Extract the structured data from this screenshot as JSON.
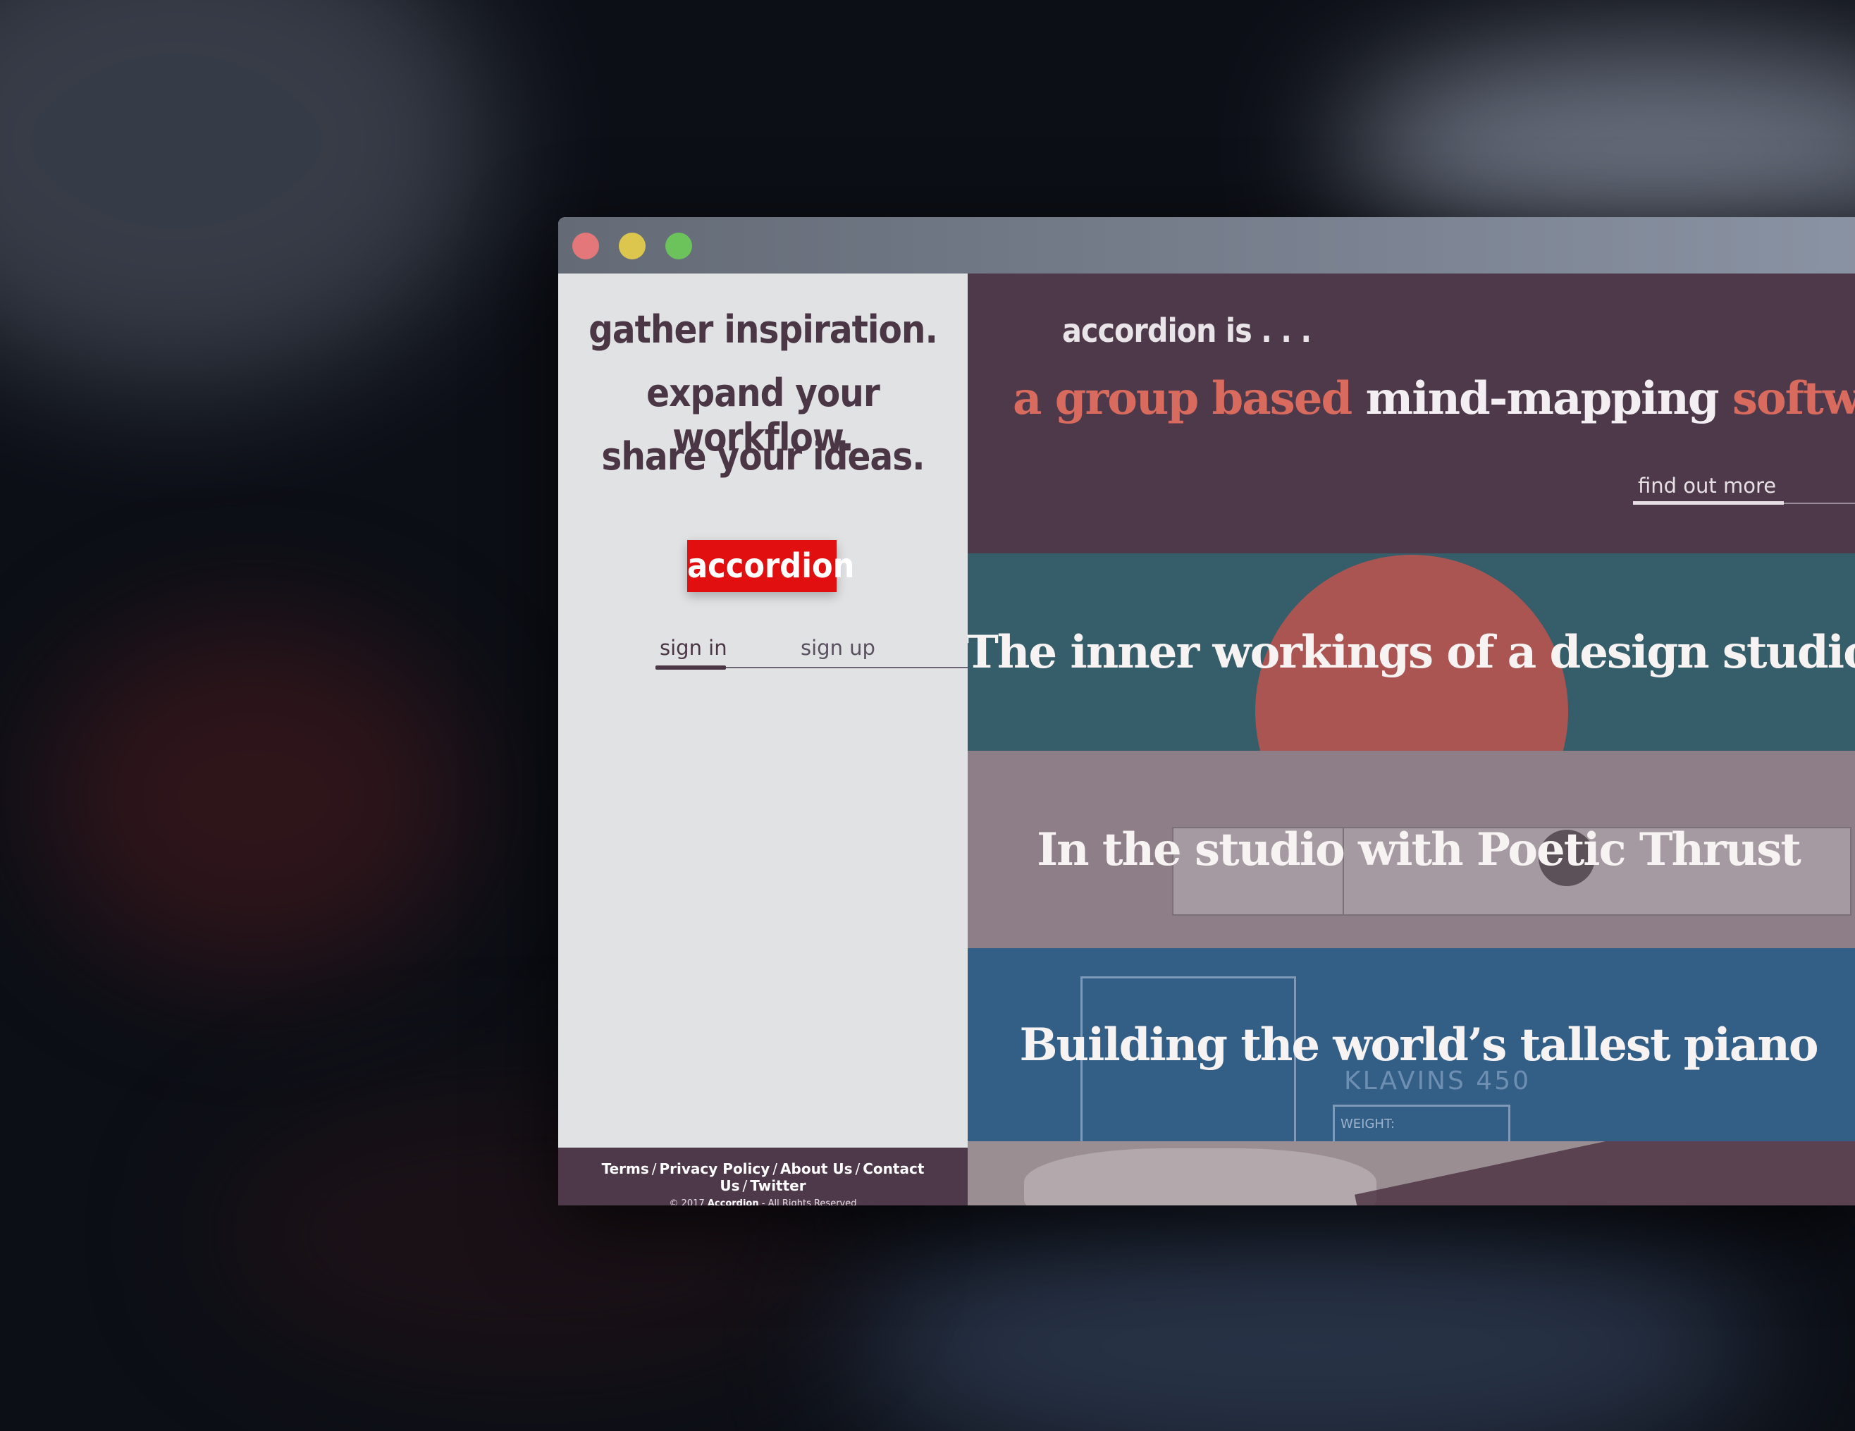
{
  "window": {
    "controls": [
      "close",
      "minimize",
      "zoom"
    ]
  },
  "left": {
    "taglines": [
      "gather inspiration.",
      "expand your workflow.",
      "share your ideas."
    ],
    "logo": "accordion",
    "auth_tabs": {
      "sign_in": "sign in",
      "sign_up": "sign up",
      "active": "sign in"
    }
  },
  "footer": {
    "links": [
      "Terms",
      "Privacy Policy",
      "About Us",
      "Contact Us",
      "Twitter"
    ],
    "separator": "/",
    "copyright_prefix": "© 2017",
    "copyright_brand": "Accordion",
    "copyright_suffix": "- All Rights Reserved"
  },
  "hero": {
    "title": "accordion is . . .",
    "subtitle_parts": [
      "a group based",
      "mind-mapping",
      "software."
    ],
    "cta": "find out more"
  },
  "cards": [
    {
      "title": "The inner workings of a design studio"
    },
    {
      "title": "In the studio with Poetic Thrust"
    },
    {
      "title": "Building the world’s tallest piano",
      "image_text": "KLAVINS 450",
      "image_label": "WEIGHT:"
    },
    {
      "title": ""
    }
  ],
  "colors": {
    "plum": "#4e394a",
    "accent_red": "#e10f0f",
    "coral": "#d96a5e",
    "teal": "#355e6a",
    "blue": "#335f87"
  }
}
